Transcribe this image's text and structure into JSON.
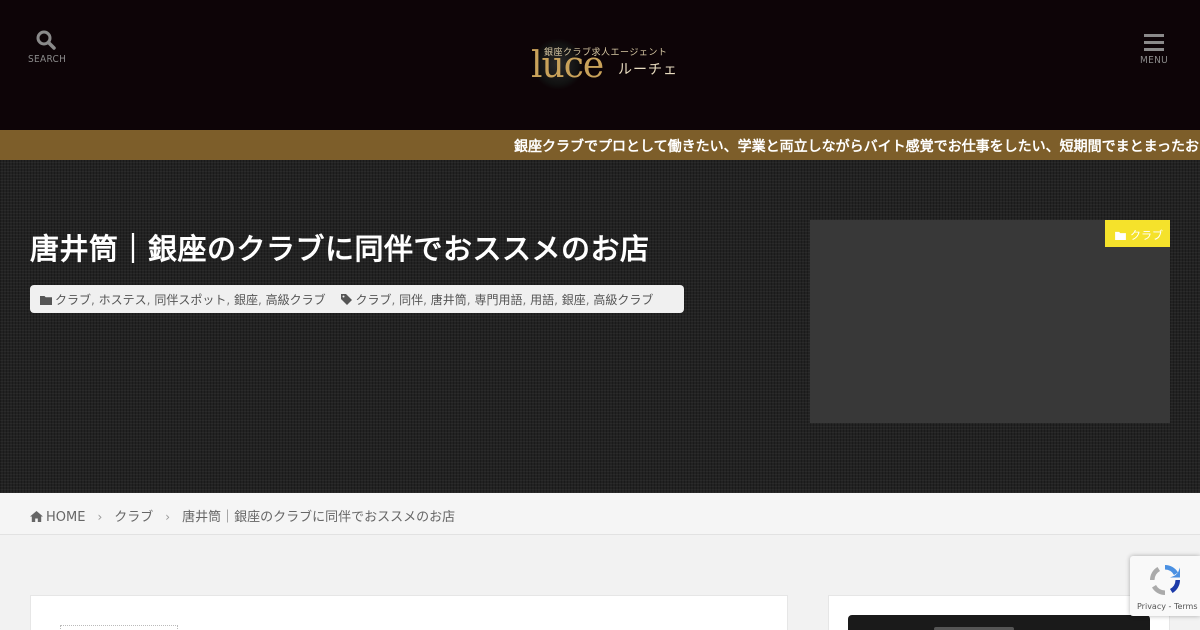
{
  "header": {
    "search_label": "SEARCH",
    "menu_label": "MENU",
    "logo": {
      "tagline": "銀座クラブ求人エージェント",
      "wordmark": "luce",
      "kana": "ルーチェ"
    }
  },
  "ticker": {
    "text": "銀座クラブでプロとして働きたい、学業と両立しながらバイト感覚でお仕事をしたい、短期間でまとまったお"
  },
  "post": {
    "title": "唐井筒｜銀座のクラブに同伴でおススメのお店",
    "categories": [
      "クラブ",
      "ホステス",
      "同伴スポット",
      "銀座",
      "高級クラブ"
    ],
    "tags": [
      "クラブ",
      "同伴",
      "唐井筒",
      "専門用語",
      "用語",
      "銀座",
      "高級クラブ"
    ],
    "category_badge": "クラブ"
  },
  "breadcrumb": {
    "home": "HOME",
    "items": [
      "クラブ",
      "唐井筒｜銀座のクラブに同伴でおススメのお店"
    ]
  },
  "recaptcha": {
    "privacy": "Privacy",
    "terms": "Terms"
  },
  "colors": {
    "header_bg": "#0d0407",
    "ticker_bg": "#7d5e2a",
    "badge_bg": "#f5e22b",
    "logo_gold": "#c9a25a"
  },
  "icons": {
    "search": "search-icon",
    "menu": "hamburger-menu-icon",
    "folder": "folder-icon",
    "tag": "tag-icon",
    "home": "home-icon",
    "chevron": "chevron-right-icon"
  }
}
